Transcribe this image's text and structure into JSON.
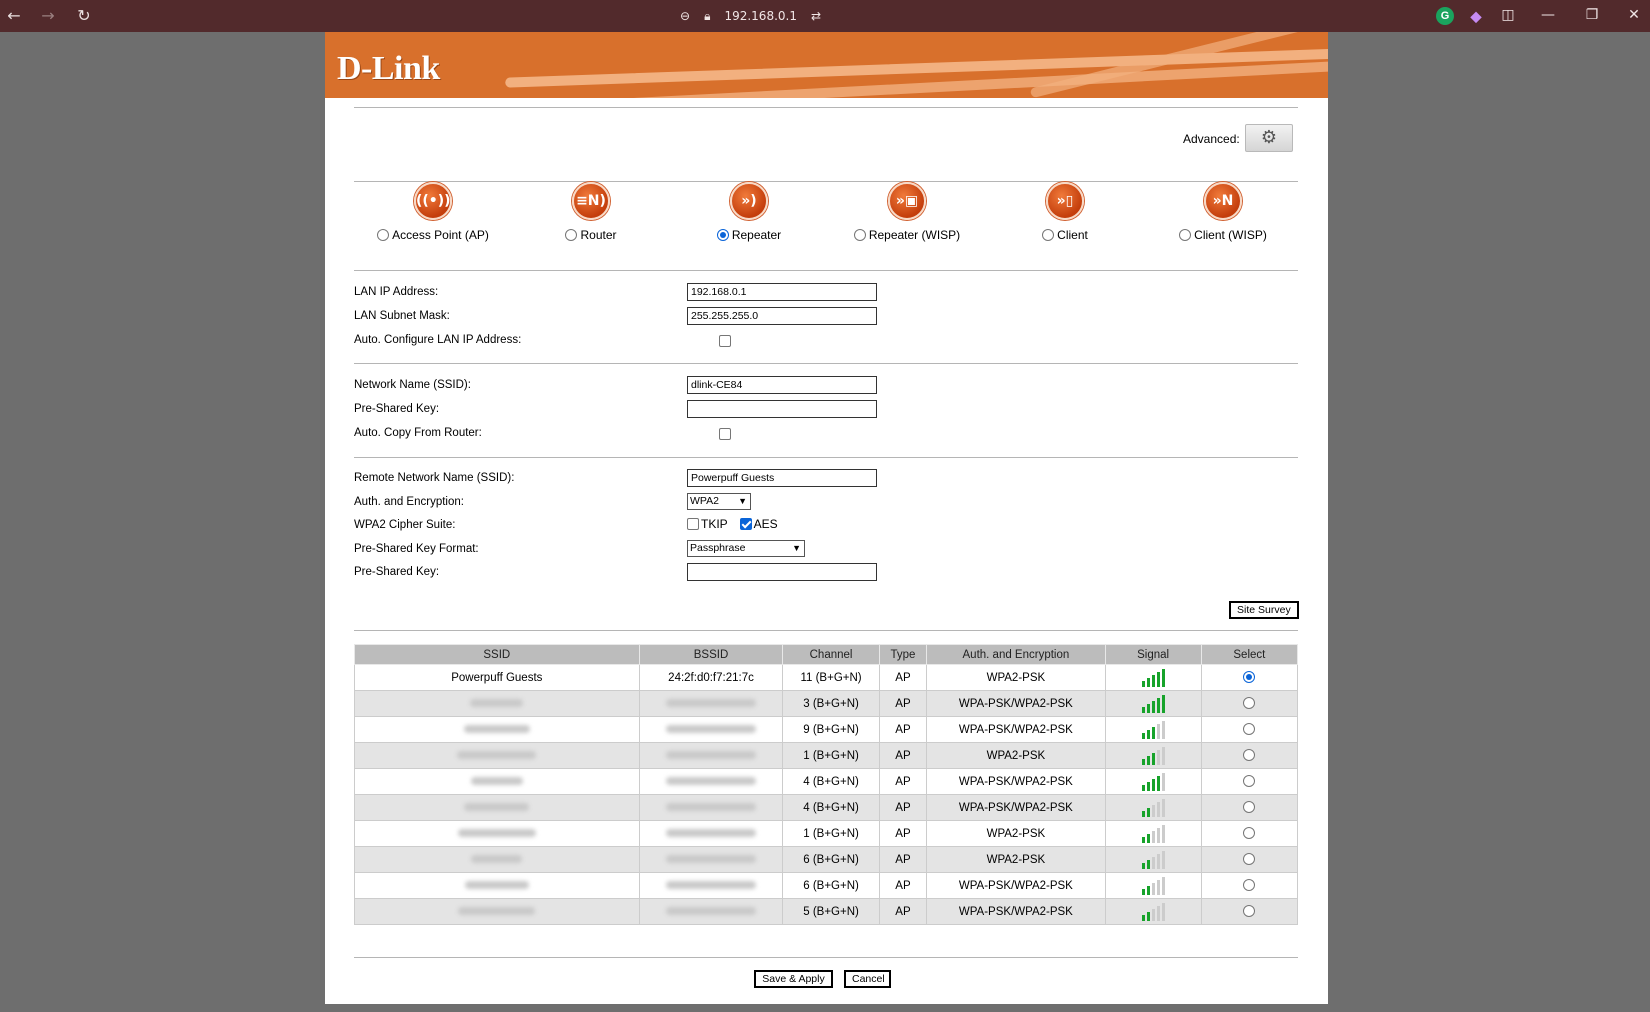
{
  "browser": {
    "back_icon": "←",
    "forward_icon": "→",
    "reload_icon": "↻",
    "address": "192.168.0.1",
    "ext_g": "G",
    "ext_p": "◆",
    "sidebar_icon": "◫",
    "min_icon": "—",
    "restore_icon": "❐",
    "close_icon": "✕"
  },
  "header": {
    "logo": "D-Link",
    "advanced_label": "Advanced:",
    "gear_icon": "⚙"
  },
  "modes": [
    {
      "label": "Access Point (AP)",
      "checked": false,
      "icon": "((•))"
    },
    {
      "label": "Router",
      "checked": false,
      "icon": "≡N)"
    },
    {
      "label": "Repeater",
      "checked": true,
      "icon": "»)"
    },
    {
      "label": "Repeater (WISP)",
      "checked": false,
      "icon": "»▣"
    },
    {
      "label": "Client",
      "checked": false,
      "icon": "»▯"
    },
    {
      "label": "Client (WISP)",
      "checked": false,
      "icon": "»N"
    }
  ],
  "lan": {
    "ip_label": "LAN IP Address:",
    "ip_value": "192.168.0.1",
    "mask_label": "LAN Subnet Mask:",
    "mask_value": "255.255.255.0",
    "auto_label": "Auto. Configure LAN IP Address:"
  },
  "wifi": {
    "ssid_label": "Network Name (SSID):",
    "ssid_value": "dlink-CE84",
    "psk_label": "Pre-Shared Key:",
    "psk_value": "",
    "copy_label": "Auto. Copy From Router:"
  },
  "remote": {
    "ssid_label": "Remote Network Name (SSID):",
    "ssid_value": "Powerpuff Guests",
    "auth_label": "Auth. and Encryption:",
    "auth_value": "WPA2",
    "cipher_label": "WPA2 Cipher Suite:",
    "tkip_label": "TKIP",
    "aes_label": "AES",
    "format_label": "Pre-Shared Key Format:",
    "format_value": "Passphrase",
    "psk_label": "Pre-Shared Key:",
    "psk_value": ""
  },
  "site_survey_label": "Site Survey",
  "table": {
    "headers": [
      "SSID",
      "BSSID",
      "Channel",
      "Type",
      "Auth. and Encryption",
      "Signal",
      "Select"
    ],
    "rows": [
      {
        "ssid": "Powerpuff Guests",
        "bssid": "24:2f:d0:f7:21:7c",
        "channel": "11 (B+G+N)",
        "type": "AP",
        "auth": "WPA2-PSK",
        "signal": 5,
        "selected": true
      },
      {
        "ssid": "",
        "bssid": "",
        "channel": "3 (B+G+N)",
        "type": "AP",
        "auth": "WPA-PSK/WPA2-PSK",
        "signal": 5,
        "selected": false
      },
      {
        "ssid": "",
        "bssid": "",
        "channel": "9 (B+G+N)",
        "type": "AP",
        "auth": "WPA-PSK/WPA2-PSK",
        "signal": 3,
        "selected": false
      },
      {
        "ssid": "",
        "bssid": "",
        "channel": "1 (B+G+N)",
        "type": "AP",
        "auth": "WPA2-PSK",
        "signal": 3,
        "selected": false
      },
      {
        "ssid": "",
        "bssid": "",
        "channel": "4 (B+G+N)",
        "type": "AP",
        "auth": "WPA-PSK/WPA2-PSK",
        "signal": 4,
        "selected": false
      },
      {
        "ssid": "",
        "bssid": "",
        "channel": "4 (B+G+N)",
        "type": "AP",
        "auth": "WPA-PSK/WPA2-PSK",
        "signal": 2,
        "selected": false
      },
      {
        "ssid": "",
        "bssid": "",
        "channel": "1 (B+G+N)",
        "type": "AP",
        "auth": "WPA2-PSK",
        "signal": 2,
        "selected": false
      },
      {
        "ssid": "",
        "bssid": "",
        "channel": "6 (B+G+N)",
        "type": "AP",
        "auth": "WPA2-PSK",
        "signal": 2,
        "selected": false
      },
      {
        "ssid": "",
        "bssid": "",
        "channel": "6 (B+G+N)",
        "type": "AP",
        "auth": "WPA-PSK/WPA2-PSK",
        "signal": 2,
        "selected": false
      },
      {
        "ssid": "",
        "bssid": "",
        "channel": "5 (B+G+N)",
        "type": "AP",
        "auth": "WPA-PSK/WPA2-PSK",
        "signal": 2,
        "selected": false
      }
    ]
  },
  "footer": {
    "save_label": "Save & Apply",
    "cancel_label": "Cancel"
  },
  "colors": {
    "brand": "#d8702c",
    "chrome": "#522a2c",
    "signal": "#17a32b"
  }
}
